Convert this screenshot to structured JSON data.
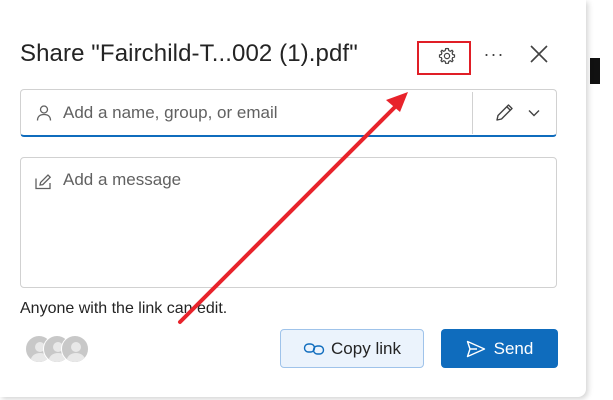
{
  "dialog": {
    "title": "Share \"Fairchild-T...002 (1).pdf\"",
    "more_label": "···"
  },
  "recipient": {
    "placeholder": "Add a name, group, or email"
  },
  "message": {
    "placeholder": "Add a message"
  },
  "link_info": "Anyone with the link can edit.",
  "buttons": {
    "copy_link": "Copy link",
    "send": "Send"
  },
  "icons": {
    "settings": "gear-icon",
    "more": "more-icon",
    "close": "close-icon",
    "person": "person-icon",
    "permission": "pencil-icon",
    "dropdown": "chevron-down-icon",
    "message": "pencil-box-icon",
    "copy_link": "link-icon",
    "send": "send-icon"
  },
  "colors": {
    "accent": "#0f6cbd",
    "annotation": "#e01e26",
    "copy_link_bg": "#ebf3fc"
  }
}
